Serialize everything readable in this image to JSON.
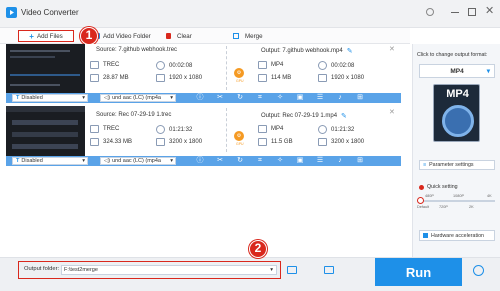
{
  "app": {
    "title": "Video Converter"
  },
  "toolbar": {
    "add_files": "Add Files",
    "add_folder": "Add Video Folder",
    "clear": "Clear",
    "merge": "Merge"
  },
  "items": [
    {
      "source": "Source: 7.github webhook.trec",
      "output": "Output: 7.github webhook.mp4",
      "src_format": "TREC",
      "src_duration": "00:02:08",
      "src_size": "28.87 MB",
      "src_res": "1920 x 1080",
      "out_format": "MP4",
      "out_duration": "00:02:08",
      "out_size": "114 MB",
      "out_res": "1920 x 1080",
      "subtitle": "Disabled",
      "audio": "und aac (LC) (mp4a"
    },
    {
      "source": "Source: Rec 07-29-19 1.trec",
      "output": "Output: Rec 07-29-19 1.mp4",
      "src_format": "TREC",
      "src_duration": "01:21:32",
      "src_size": "324.33 MB",
      "src_res": "3200 x 1800",
      "out_format": "MP4",
      "out_duration": "01:21:32",
      "out_size": "11.5 GB",
      "out_res": "3200 x 1800",
      "subtitle": "Disabled",
      "audio": "und aac (LC) (mp4a"
    }
  ],
  "gpu_label": "GPU",
  "sidebar": {
    "hint": "Click to change output format:",
    "format": "MP4",
    "format_badge": "MP4",
    "param_settings": "Parameter settings",
    "quick_setting": "Quick setting",
    "quality_ticks": [
      "480P",
      "1080P",
      "4K"
    ],
    "quality_ticks2": [
      "Default",
      "720P",
      "2K"
    ],
    "hw_accel": "Hardware acceleration"
  },
  "bottom": {
    "output_label": "Output folder:",
    "output_path": "F:\\test2merge",
    "run": "Run"
  },
  "annotations": {
    "one": "1",
    "two": "2"
  },
  "colors": {
    "accent": "#1e90e8",
    "strip": "#5aa3e8",
    "callout": "#d9281d",
    "gpu": "#f59a23"
  }
}
